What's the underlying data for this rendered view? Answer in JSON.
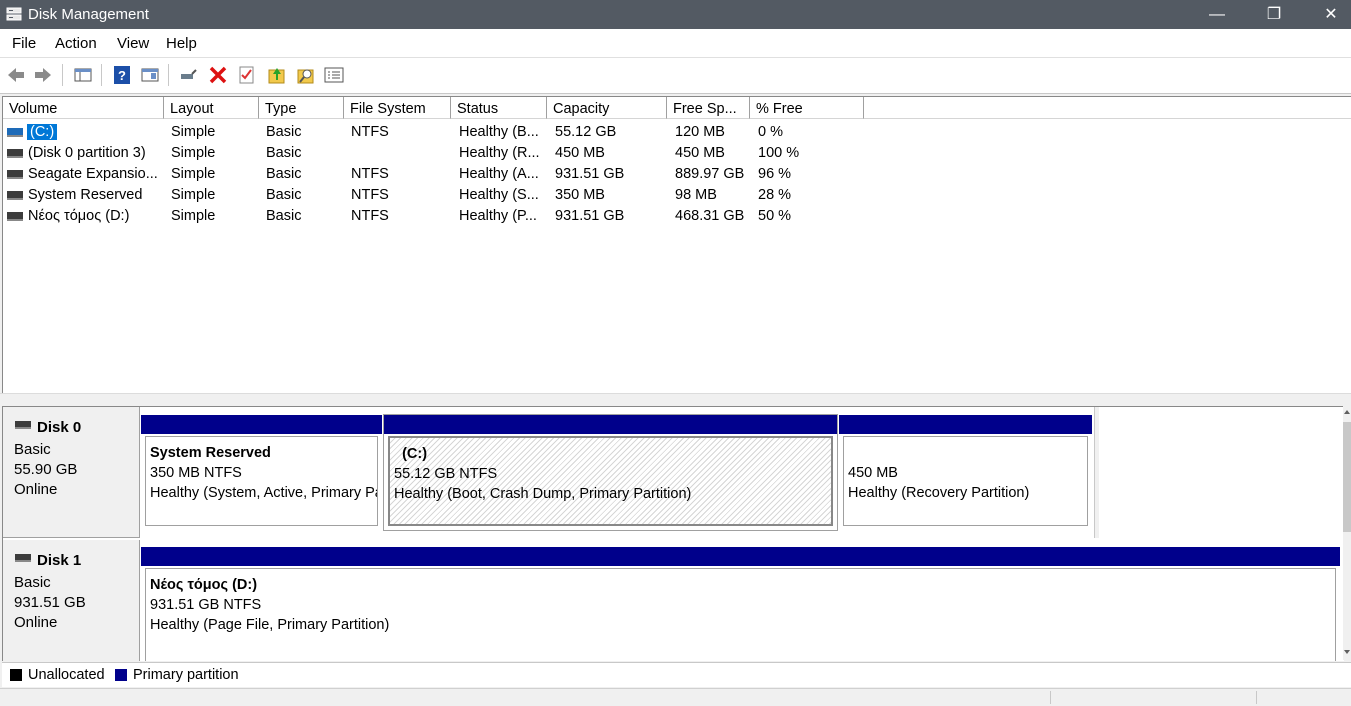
{
  "window": {
    "title": "Disk Management",
    "minimize": "—",
    "restore": "❐",
    "close": "✕"
  },
  "menu": [
    "File",
    "Action",
    "View",
    "Help"
  ],
  "toolbar": [
    "back-icon",
    "forward-icon",
    "console-tree-icon",
    "help-icon",
    "show-pane-icon",
    "connect-drive-icon",
    "delete-icon",
    "check-icon",
    "refresh-icon",
    "rescan-icon",
    "properties-icon"
  ],
  "columns": [
    "Volume",
    "Layout",
    "Type",
    "File System",
    "Status",
    "Capacity",
    "Free Sp...",
    "% Free"
  ],
  "volumes": [
    [
      "(C:)",
      "Simple",
      "Basic",
      "NTFS",
      "Healthy (B...",
      "55.12 GB",
      "120 MB",
      "0 %"
    ],
    [
      "(Disk 0 partition 3)",
      "Simple",
      "Basic",
      "",
      "Healthy (R...",
      "450 MB",
      "450 MB",
      "100 %"
    ],
    [
      "Seagate Expansio...",
      "Simple",
      "Basic",
      "NTFS",
      "Healthy (A...",
      "931.51 GB",
      "889.97 GB",
      "96 %"
    ],
    [
      "System Reserved",
      "Simple",
      "Basic",
      "NTFS",
      "Healthy (S...",
      "350 MB",
      "98 MB",
      "28 %"
    ],
    [
      "Νέος τόμος (D:)",
      "Simple",
      "Basic",
      "NTFS",
      "Healthy (P...",
      "931.51 GB",
      "468.31 GB",
      "50 %"
    ]
  ],
  "disks": [
    {
      "name": "Disk 0",
      "type": "Basic",
      "size": "55.90 GB",
      "state": "Online",
      "partitions": [
        {
          "name": "System Reserved",
          "detail": "350 MB NTFS",
          "status": "Healthy (System, Active, Primary Partition)"
        },
        {
          "name": "(C:)",
          "detail": "55.12 GB NTFS",
          "status": "Healthy (Boot, Crash Dump, Primary Partition)"
        },
        {
          "name": "",
          "detail": "450 MB",
          "status": "Healthy (Recovery Partition)"
        }
      ]
    },
    {
      "name": "Disk 1",
      "type": "Basic",
      "size": "931.51 GB",
      "state": "Online",
      "partitions": [
        {
          "name": "Νέος τόμος  (D:)",
          "detail": "931.51 GB NTFS",
          "status": "Healthy (Page File, Primary Partition)"
        }
      ]
    }
  ],
  "legend": {
    "unallocated": "Unallocated",
    "primary": "Primary partition"
  },
  "colors": {
    "primary_partition": "#00008b",
    "unallocated": "#000000",
    "selection": "#0078d7",
    "titlebar": "#535a63"
  }
}
